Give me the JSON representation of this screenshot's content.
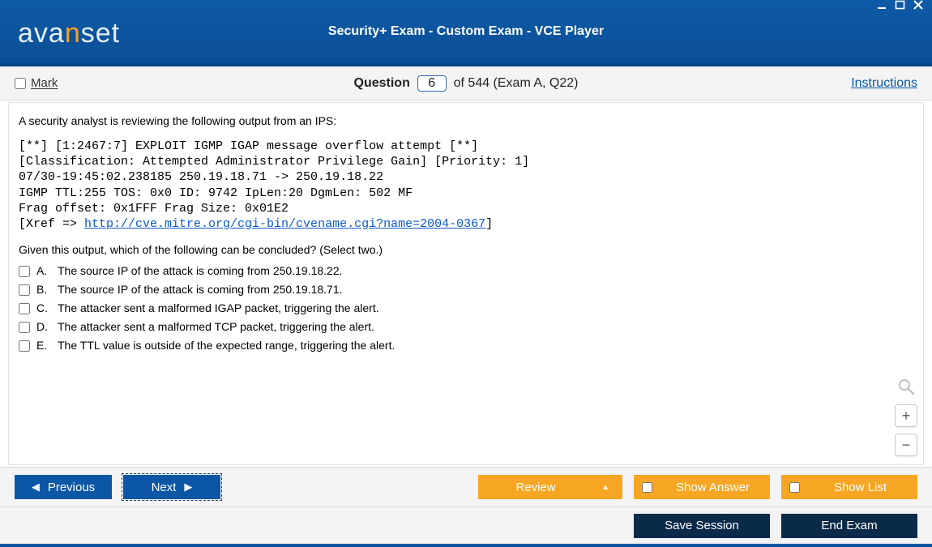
{
  "window": {
    "brand_prefix": "ava",
    "brand_accent": "n",
    "brand_suffix": "set",
    "title": "Security+ Exam - Custom Exam - VCE Player"
  },
  "toolbar": {
    "mark_label": "Mark",
    "question_word": "Question",
    "question_number": "6",
    "of_text": "of 544 (Exam A, Q22)",
    "instructions_label": "Instructions"
  },
  "question": {
    "prompt": "A security analyst is reviewing the following output from an IPS:",
    "ips_lines": [
      "[**] [1:2467:7] EXPLOIT IGMP IGAP message overflow attempt [**]",
      "[Classification: Attempted Administrator Privilege Gain] [Priority: 1]",
      "07/30-19:45:02.238185 250.19.18.71 -> 250.19.18.22",
      "IGMP TTL:255 TOS: 0x0 ID: 9742 IpLen:20 DgmLen: 502 MF",
      "Frag offset: 0x1FFF Frag Size: 0x01E2"
    ],
    "xref_prefix": "[Xref => ",
    "xref_link": "http://cve.mitre.org/cgi-bin/cvename.cgi?name=2004-0367",
    "xref_suffix": "]",
    "subprompt": "Given this output, which of the following can be concluded? (Select two.)",
    "options": [
      {
        "label": "A.",
        "text": "The source IP of the attack is coming from 250.19.18.22."
      },
      {
        "label": "B.",
        "text": "The source IP of the attack is coming from 250.19.18.71."
      },
      {
        "label": "C.",
        "text": "The attacker sent a malformed IGAP packet, triggering the alert."
      },
      {
        "label": "D.",
        "text": "The attacker sent a malformed TCP packet, triggering the alert."
      },
      {
        "label": "E.",
        "text": "The TTL value is outside of the expected range, triggering the alert."
      }
    ]
  },
  "nav": {
    "previous": "Previous",
    "next": "Next",
    "review": "Review",
    "show_answer": "Show Answer",
    "show_list": "Show List"
  },
  "footer": {
    "save_session": "Save Session",
    "end_exam": "End Exam"
  }
}
